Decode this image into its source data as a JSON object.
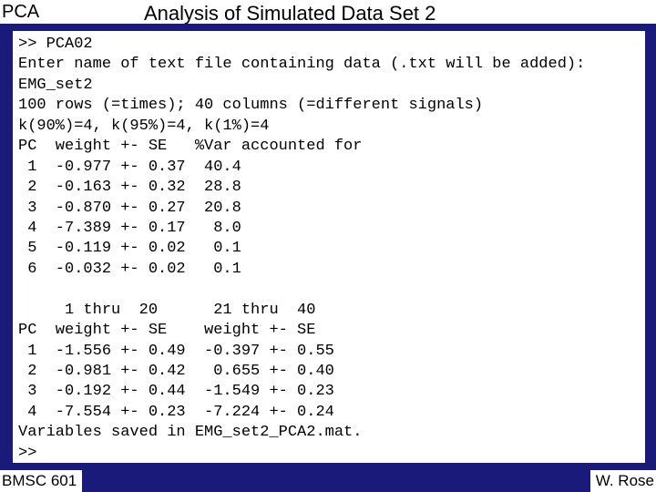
{
  "header": {
    "tag": "PCA",
    "title": "Analysis of Simulated Data Set 2"
  },
  "terminal": {
    "lines": [
      ">> PCA02",
      "Enter name of text file containing data (.txt will be added):",
      "EMG_set2",
      "100 rows (=times); 40 columns (=different signals)",
      "k(90%)=4, k(95%)=4, k(1%)=4",
      "PC  weight +- SE   %Var accounted for",
      " 1  -0.977 +- 0.37  40.4",
      " 2  -0.163 +- 0.32  28.8",
      " 3  -0.870 +- 0.27  20.8",
      " 4  -7.389 +- 0.17   8.0",
      " 5  -0.119 +- 0.02   0.1",
      " 6  -0.032 +- 0.02   0.1",
      "",
      "     1 thru  20      21 thru  40",
      "PC  weight +- SE    weight +- SE",
      " 1  -1.556 +- 0.49  -0.397 +- 0.55",
      " 2  -0.981 +- 0.42   0.655 +- 0.40",
      " 3  -0.192 +- 0.44  -1.549 +- 0.23",
      " 4  -7.554 +- 0.23  -7.224 +- 0.24",
      "Variables saved in EMG_set2_PCA2.mat.",
      ">>"
    ]
  },
  "footer": {
    "left": "BMSC 601",
    "right": "W. Rose"
  },
  "chart_data": {
    "type": "table",
    "title": "PCA output for EMG_set2",
    "k_thresholds": {
      "k_90pct": 4,
      "k_95pct": 4,
      "k_1pct": 4
    },
    "dimensions": {
      "rows": 100,
      "rows_meaning": "times",
      "cols": 40,
      "cols_meaning": "different signals"
    },
    "overall": {
      "columns": [
        "PC",
        "weight",
        "SE",
        "pct_var_accounted_for"
      ],
      "rows": [
        [
          1,
          -0.977,
          0.37,
          40.4
        ],
        [
          2,
          -0.163,
          0.32,
          28.8
        ],
        [
          3,
          -0.87,
          0.27,
          20.8
        ],
        [
          4,
          -7.389,
          0.17,
          8.0
        ],
        [
          5,
          -0.119,
          0.02,
          0.1
        ],
        [
          6,
          -0.032,
          0.02,
          0.1
        ]
      ]
    },
    "split": {
      "group_a": "1 thru 20",
      "group_b": "21 thru 40",
      "columns": [
        "PC",
        "weight_a",
        "SE_a",
        "weight_b",
        "SE_b"
      ],
      "rows": [
        [
          1,
          -1.556,
          0.49,
          -0.397,
          0.55
        ],
        [
          2,
          -0.981,
          0.42,
          0.655,
          0.4
        ],
        [
          3,
          -0.192,
          0.44,
          -1.549,
          0.23
        ],
        [
          4,
          -7.554,
          0.23,
          -7.224,
          0.24
        ]
      ]
    },
    "saved_file": "EMG_set2_PCA2.mat"
  }
}
